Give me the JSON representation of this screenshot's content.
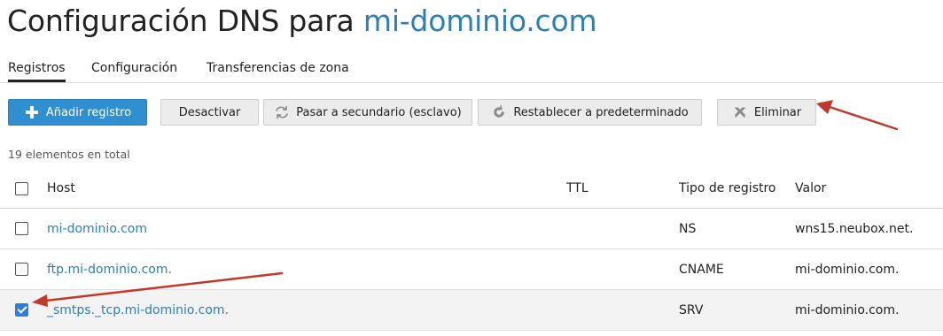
{
  "title": {
    "prefix": "Configuración DNS para ",
    "domain": "mi-dominio.com"
  },
  "tabs": [
    {
      "label": "Registros",
      "active": true
    },
    {
      "label": "Configuración",
      "active": false
    },
    {
      "label": "Transferencias de zona",
      "active": false
    }
  ],
  "toolbar": {
    "add_label": "Añadir registro",
    "deactivate_label": "Desactivar",
    "secondary_label": "Pasar a secundario (esclavo)",
    "reset_label": "Restablecer a predeterminado",
    "delete_label": "Eliminar"
  },
  "total_text": "19 elementos en total",
  "table": {
    "headers": {
      "host": "Host",
      "ttl": "TTL",
      "type": "Tipo de registro",
      "value": "Valor"
    },
    "rows": [
      {
        "host": "mi-dominio.com",
        "ttl": "",
        "type": "NS",
        "value": "wns15.neubox.net.",
        "checked": false
      },
      {
        "host": "ftp.mi-dominio.com.",
        "ttl": "",
        "type": "CNAME",
        "value": "mi-dominio.com.",
        "checked": false
      },
      {
        "host": "_smtps._tcp.mi-dominio.com.",
        "ttl": "",
        "type": "SRV",
        "value": "mi-dominio.com.",
        "checked": true
      }
    ]
  },
  "colors": {
    "link": "#2f7fb4",
    "primary": "#2f8fd0",
    "arrow": "#c0392b",
    "checkbox": "#2f7fd6"
  },
  "icons": {
    "add": "plus-icon",
    "secondary": "swap-arrows-icon",
    "reset": "refresh-icon",
    "delete": "x-icon"
  }
}
